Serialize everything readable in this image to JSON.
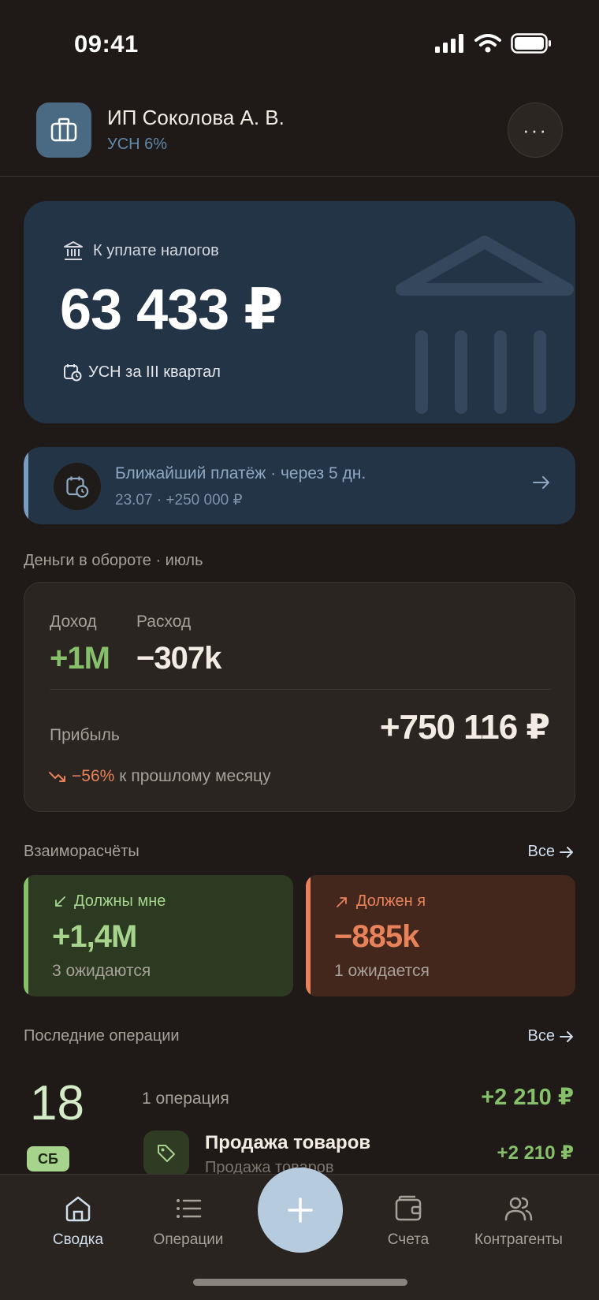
{
  "status_bar": {
    "time": "09:41"
  },
  "header": {
    "org_name": "ИП Соколова А. В.",
    "tax_regime": "УСН 6%",
    "more_label": "···"
  },
  "tax_card": {
    "label": "К уплате налогов",
    "amount": "63 433 ₽",
    "period": "УСН за III квартал"
  },
  "next_payment": {
    "title": "Ближайший платёж · через 5 дн.",
    "subtitle": "23.07 · +250 000 ₽"
  },
  "money": {
    "section_title": "Деньги в обороте · июль",
    "income_label": "Доход",
    "income_value": "+1M",
    "expense_label": "Расход",
    "expense_value": "−307k",
    "profit_label": "Прибыль",
    "profit_value": "+750 116 ₽",
    "change_pct": "−56%",
    "change_text": "к прошлому месяцу"
  },
  "settlements": {
    "section_title": "Взаиморасчёты",
    "all_label": "Все",
    "owed_to_me": {
      "label": "Должны мне",
      "value": "+1,4M",
      "sub": "3 ожидаются"
    },
    "i_owe": {
      "label": "Должен я",
      "value": "−885k",
      "sub": "1 ожидается"
    }
  },
  "operations": {
    "section_title": "Последние операции",
    "all_label": "Все",
    "day": "18",
    "weekday": "СБ",
    "count_label": "1 операция",
    "day_total": "+2 210 ₽",
    "item": {
      "title": "Продажа товаров",
      "subtitle": "Продажа товаров",
      "amount": "+2 210 ₽"
    }
  },
  "tab_bar": {
    "items": [
      {
        "label": "Сводка",
        "icon": "home-icon",
        "active": true
      },
      {
        "label": "Операции",
        "icon": "list-icon",
        "active": false
      },
      {
        "label": "Счета",
        "icon": "wallet-icon",
        "active": false
      },
      {
        "label": "Контрагенты",
        "icon": "users-icon",
        "active": false
      }
    ],
    "fab_icon": "plus-icon"
  },
  "colors": {
    "background": "#1f1a17",
    "tax_card": "#243447",
    "income": "#86c06a",
    "negative_accent": "#e8825a",
    "link": "#d0ddea",
    "fab": "#b7cbdf"
  }
}
